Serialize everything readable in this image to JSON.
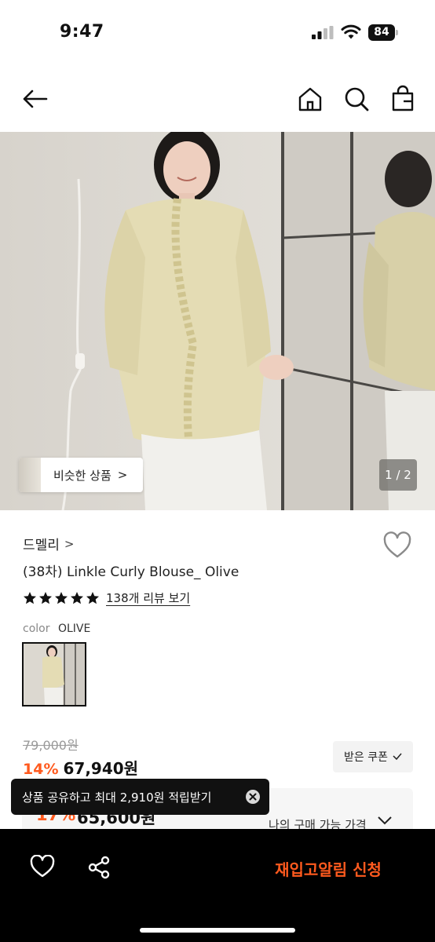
{
  "status_bar": {
    "time": "9:47",
    "battery": "84",
    "icons": [
      "signal-icon",
      "wifi-icon",
      "battery-icon"
    ]
  },
  "nav": {
    "icons": [
      "back-arrow-icon",
      "home-icon",
      "search-icon",
      "shopping-bag-icon"
    ]
  },
  "gallery": {
    "similar_label": "비슷한 상품",
    "similar_chevron": ">",
    "page_indicator": "1 / 2"
  },
  "product": {
    "brand": "드멜리",
    "brand_chevron": ">",
    "title": "(38차) Linkle Curly Blouse_ Olive",
    "rating_stars": 5,
    "review_link": "138개 리뷰 보기",
    "color_label": "color",
    "color_value": "OLIVE",
    "original_price": "79,000원",
    "discount": "14%",
    "sale_price": "67,940원",
    "coupon_label": "받은 쿠폰"
  },
  "buy_box": {
    "pct": "17%",
    "price": "65,600원",
    "label": "나의 구매 가능 가격"
  },
  "toast": {
    "text": "상품 공유하고 최대 2,910원 적립받기"
  },
  "bottom_bar": {
    "restock_label": "재입고알림 신청"
  },
  "colors": {
    "accent": "#ff5a1e",
    "dark": "#111111",
    "muted": "#9a9a9a"
  }
}
